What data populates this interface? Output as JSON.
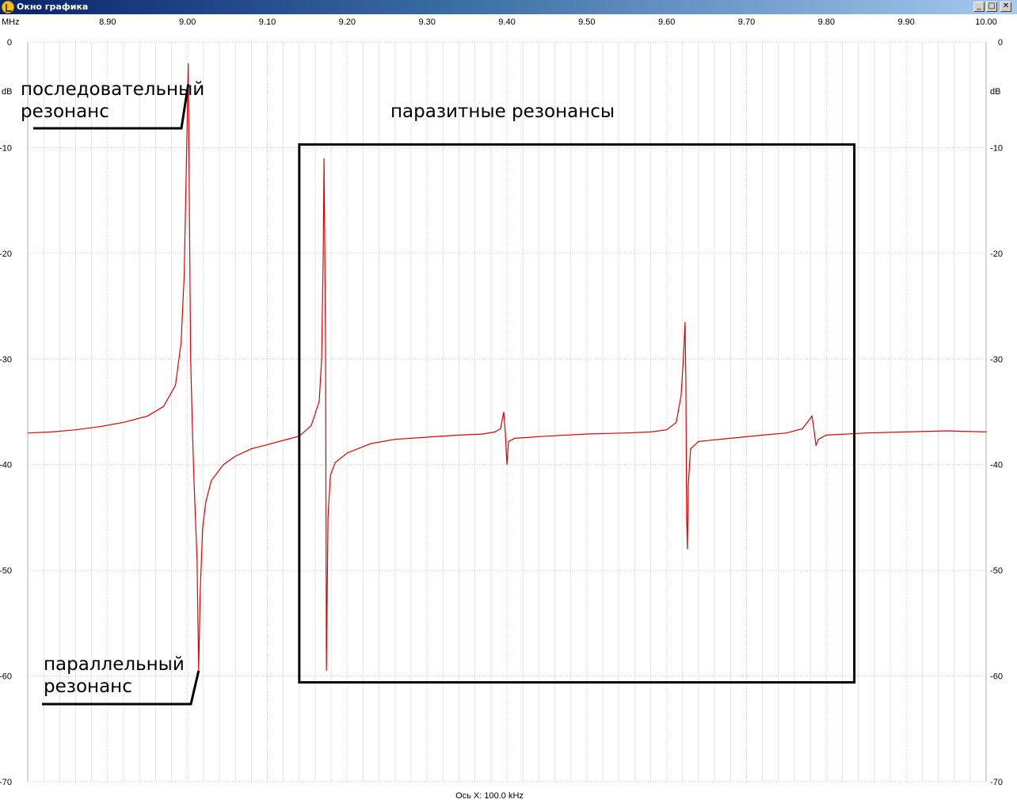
{
  "window": {
    "title": "Окно графика",
    "icon": "oscilloscope-app-icon",
    "controls": {
      "minimize": "_",
      "maximize": "□",
      "close": "✕"
    }
  },
  "colors": {
    "trace": "#e00000",
    "grid": "#c8c8c8",
    "axis_text": "#000000",
    "titlebar": "#0a246a"
  },
  "chart_data": {
    "type": "line",
    "xunit": "MHz",
    "yunit": "dB",
    "xlim": [
      8.8,
      10.0
    ],
    "ylim": [
      -70,
      0
    ],
    "x_ticks": [
      "8.90",
      "9.00",
      "9.10",
      "9.20",
      "9.30",
      "9.40",
      "9.50",
      "9.60",
      "9.70",
      "9.80",
      "9.90",
      "10.00"
    ],
    "x_tick_values": [
      8.9,
      9.0,
      9.1,
      9.2,
      9.3,
      9.4,
      9.5,
      9.6,
      9.7,
      9.8,
      9.9,
      10.0
    ],
    "y_ticks": [
      "0",
      "-10",
      "-20",
      "-30",
      "-40",
      "-50",
      "-60",
      "-70"
    ],
    "y_tick_values": [
      0,
      -10,
      -20,
      -30,
      -40,
      -50,
      -60,
      -70
    ],
    "xlabel": "Ось X: 100.0 kHz",
    "grid": true,
    "series": [
      {
        "color": "#e00000",
        "points": [
          [
            8.8,
            -37.0
          ],
          [
            8.83,
            -36.9
          ],
          [
            8.86,
            -36.7
          ],
          [
            8.89,
            -36.4
          ],
          [
            8.92,
            -36.0
          ],
          [
            8.95,
            -35.4
          ],
          [
            8.97,
            -34.5
          ],
          [
            8.985,
            -32.5
          ],
          [
            8.992,
            -28.5
          ],
          [
            8.996,
            -22.0
          ],
          [
            8.999,
            -10.0
          ],
          [
            9.001,
            -2.0
          ],
          [
            9.002,
            -12.0
          ],
          [
            9.004,
            -30.0
          ],
          [
            9.006,
            -36.0
          ],
          [
            9.008,
            -41.0
          ],
          [
            9.01,
            -45.0
          ],
          [
            9.012,
            -49.0
          ],
          [
            9.014,
            -59.5
          ],
          [
            9.016,
            -52.0
          ],
          [
            9.019,
            -46.0
          ],
          [
            9.023,
            -43.5
          ],
          [
            9.03,
            -41.5
          ],
          [
            9.045,
            -40.0
          ],
          [
            9.06,
            -39.2
          ],
          [
            9.08,
            -38.5
          ],
          [
            9.1,
            -38.1
          ],
          [
            9.12,
            -37.7
          ],
          [
            9.14,
            -37.3
          ],
          [
            9.155,
            -36.3
          ],
          [
            9.165,
            -34.0
          ],
          [
            9.168,
            -30.0
          ],
          [
            9.17,
            -20.0
          ],
          [
            9.171,
            -11.0
          ],
          [
            9.172,
            -20.0
          ],
          [
            9.173,
            -30.0
          ],
          [
            9.174,
            -59.5
          ],
          [
            9.176,
            -45.0
          ],
          [
            9.179,
            -41.0
          ],
          [
            9.185,
            -39.8
          ],
          [
            9.2,
            -38.9
          ],
          [
            9.23,
            -38.0
          ],
          [
            9.26,
            -37.6
          ],
          [
            9.3,
            -37.4
          ],
          [
            9.34,
            -37.2
          ],
          [
            9.37,
            -37.1
          ],
          [
            9.385,
            -36.9
          ],
          [
            9.392,
            -36.6
          ],
          [
            9.396,
            -35.0
          ],
          [
            9.398,
            -37.0
          ],
          [
            9.4,
            -40.0
          ],
          [
            9.402,
            -37.8
          ],
          [
            9.41,
            -37.5
          ],
          [
            9.45,
            -37.3
          ],
          [
            9.5,
            -37.1
          ],
          [
            9.55,
            -37.0
          ],
          [
            9.58,
            -36.9
          ],
          [
            9.6,
            -36.7
          ],
          [
            9.612,
            -36.0
          ],
          [
            9.618,
            -33.5
          ],
          [
            9.621,
            -30.0
          ],
          [
            9.623,
            -26.5
          ],
          [
            9.624,
            -32.0
          ],
          [
            9.625,
            -45.0
          ],
          [
            9.626,
            -48.0
          ],
          [
            9.627,
            -42.0
          ],
          [
            9.63,
            -38.5
          ],
          [
            9.64,
            -37.8
          ],
          [
            9.68,
            -37.5
          ],
          [
            9.72,
            -37.2
          ],
          [
            9.75,
            -37.0
          ],
          [
            9.77,
            -36.6
          ],
          [
            9.778,
            -35.8
          ],
          [
            9.782,
            -35.4
          ],
          [
            9.785,
            -37.0
          ],
          [
            9.787,
            -38.2
          ],
          [
            9.79,
            -37.6
          ],
          [
            9.8,
            -37.2
          ],
          [
            9.85,
            -37.0
          ],
          [
            9.9,
            -36.9
          ],
          [
            9.95,
            -36.8
          ],
          [
            10.0,
            -36.9
          ]
        ]
      }
    ],
    "annotations": [
      {
        "text": [
          "последовательный",
          "резонанс"
        ],
        "target": [
          9.001,
          -4.0
        ]
      },
      {
        "text": [
          "параллельный",
          "резонанс"
        ],
        "target": [
          9.014,
          -59.5
        ]
      },
      {
        "text": [
          "паразитные резонансы"
        ],
        "box": {
          "x": [
            9.14,
            9.835
          ],
          "y": [
            -9.7,
            -60.6
          ]
        }
      }
    ]
  }
}
